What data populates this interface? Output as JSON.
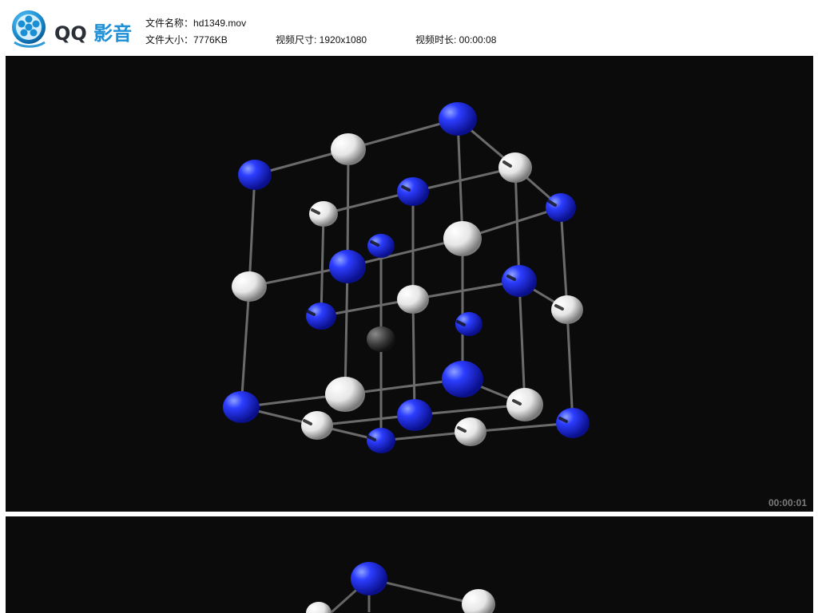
{
  "app": {
    "brand_left": "QQ",
    "brand_right": "影音"
  },
  "file": {
    "name_label": "文件名称：",
    "name_value": "hd1349.mov",
    "size_label": "文件大小：",
    "size_value": "7776KB",
    "dimension_label": "视频尺寸: ",
    "dimension_value": "1920x1080",
    "duration_label": "视频时长: ",
    "duration_value": "00:00:08"
  },
  "frames": [
    {
      "timestamp": "00:00:01"
    },
    {
      "timestamp": ""
    }
  ],
  "colors": {
    "accent": "#1f8fd6",
    "frame_bg": "#0b0b0b",
    "blue_atom": "#1f2bd8",
    "white_atom": "#f1f1f1",
    "bond": "#8b8b8b"
  },
  "icons": {
    "logo": "film-reel-icon"
  }
}
